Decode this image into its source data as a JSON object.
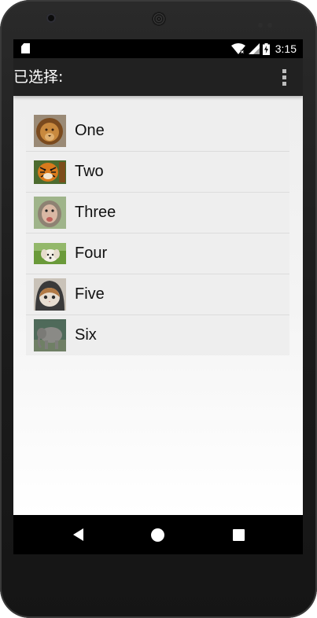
{
  "status_bar": {
    "time": "3:15",
    "icons": [
      "sd-card-icon",
      "wifi-icon",
      "cellular-signal-icon",
      "battery-charging-icon"
    ]
  },
  "app_bar": {
    "title": "已选择:",
    "overflow_icon": "more-vert-icon"
  },
  "list": {
    "items": [
      {
        "label": "One",
        "image": "lion"
      },
      {
        "label": "Two",
        "image": "tiger"
      },
      {
        "label": "Three",
        "image": "monkey"
      },
      {
        "label": "Four",
        "image": "puppy"
      },
      {
        "label": "Five",
        "image": "cat"
      },
      {
        "label": "Six",
        "image": "elephant"
      }
    ]
  },
  "nav_bar": {
    "buttons": [
      "back-icon",
      "home-icon",
      "recents-icon"
    ]
  }
}
